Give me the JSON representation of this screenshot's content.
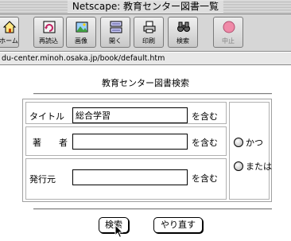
{
  "window": {
    "title": "Netscape: 教育センター図書一覧"
  },
  "toolbar": {
    "home_label": "ホーム",
    "reload_label": "再読込",
    "images_label": "画像",
    "open_label": "開く",
    "print_label": "印刷",
    "find_label": "検索",
    "stop_label": "中止"
  },
  "location": {
    "url": "du-center.minoh.osaka.jp/book/default.htm"
  },
  "page": {
    "heading": "教育センター図書検索",
    "fields": [
      {
        "label": "タイトル",
        "value": "総合学習",
        "suffix": "を含む"
      },
      {
        "label": "著　　者",
        "value": "",
        "suffix": "を含む"
      },
      {
        "label": "発行元",
        "value": "",
        "suffix": "を含む"
      }
    ],
    "options": [
      {
        "label": "かつ"
      },
      {
        "label": "または"
      }
    ],
    "search_button": "検索",
    "reset_button": "やり直す"
  }
}
